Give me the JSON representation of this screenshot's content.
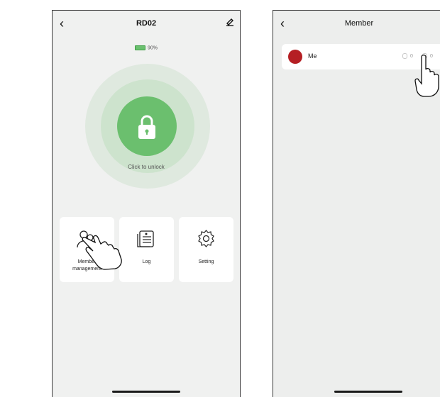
{
  "left_screen": {
    "header": {
      "back_icon": "chevron-left-icon",
      "title": "RD02",
      "edit_icon": "pen-icon"
    },
    "battery": {
      "icon": "battery-icon",
      "level": 0.9,
      "text": "90%",
      "color": "#6ac06e"
    },
    "lock": {
      "icon": "padlock-icon",
      "label": "Click to unlock",
      "accent": "#6bbf6e"
    },
    "cards": [
      {
        "icon": "member-icon",
        "label": "Member management"
      },
      {
        "icon": "log-icon",
        "label": "Log"
      },
      {
        "icon": "gear-icon",
        "label": "Setting"
      }
    ]
  },
  "right_screen": {
    "header": {
      "back_icon": "chevron-left-icon",
      "title": "Member"
    },
    "members": [
      {
        "name": "Me",
        "avatar_color": "#b51f24",
        "fingerprint_count": "0",
        "card_count": "0"
      }
    ]
  },
  "overlays": {
    "pointer_icon": "hand-pointer-icon"
  }
}
